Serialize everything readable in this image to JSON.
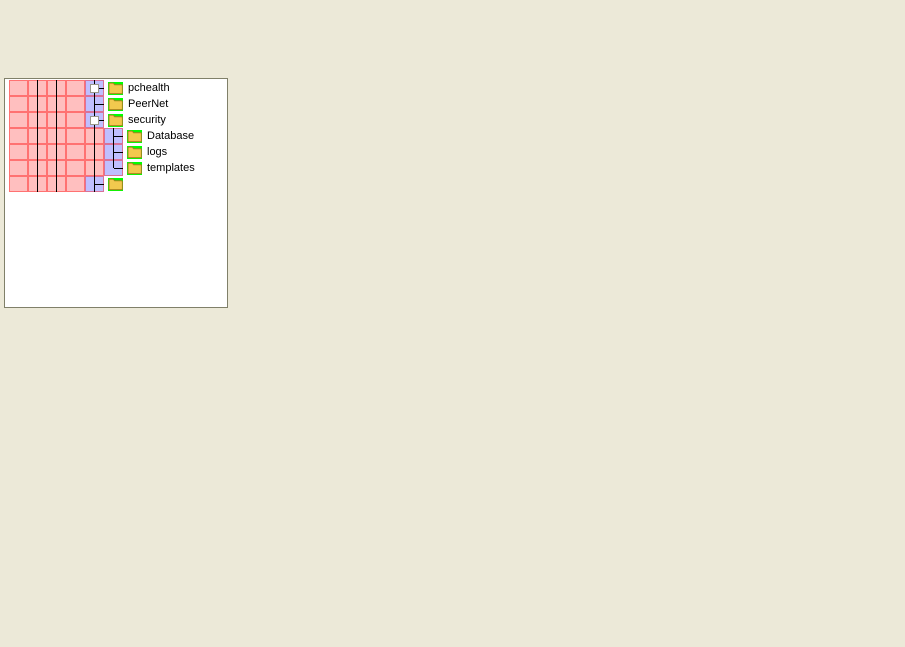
{
  "explorer": {
    "tree": {
      "items": [
        {
          "label": "pchealth",
          "icon": "folder",
          "expander": "+"
        },
        {
          "label": "PeerNet",
          "icon": "folder"
        },
        {
          "label": "security",
          "icon": "folder",
          "expander": "-",
          "selected": true,
          "children": [
            {
              "label": "Database",
              "icon": "folder"
            },
            {
              "label": "logs",
              "icon": "folder"
            },
            {
              "label": "templates",
              "icon": "folder"
            }
          ]
        },
        {
          "label": "",
          "icon": "folder"
        }
      ]
    }
  }
}
